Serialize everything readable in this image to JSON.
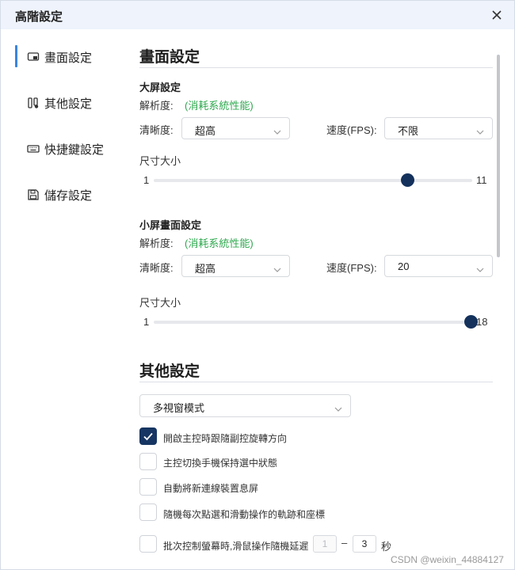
{
  "window": {
    "title": "高階設定"
  },
  "sidebar": {
    "items": [
      {
        "label": "畫面設定",
        "icon": "display-icon",
        "active": true
      },
      {
        "label": "其他設定",
        "icon": "controls-icon",
        "active": false
      },
      {
        "label": "快捷鍵設定",
        "icon": "keyboard-icon",
        "active": false
      },
      {
        "label": "儲存設定",
        "icon": "save-icon",
        "active": false
      }
    ]
  },
  "display_settings": {
    "title": "畫面設定",
    "large": {
      "title": "大屏設定",
      "resolution_label": "解析度:",
      "resolution_value": "(消耗系統性能)",
      "clarity_label": "清晰度:",
      "clarity_value": "超高",
      "fps_label": "速度(FPS):",
      "fps_value": "不限",
      "size_label": "尺寸大小",
      "size_min": "1",
      "size_max": "11",
      "size_value": 9
    },
    "small": {
      "title": "小屏畫面設定",
      "resolution_label": "解析度:",
      "resolution_value": "(消耗系統性能)",
      "clarity_label": "清晰度:",
      "clarity_value": "超高",
      "fps_label": "速度(FPS):",
      "fps_value": "20",
      "size_label": "尺寸大小",
      "size_min": "1",
      "size_max": "18",
      "size_value": 18
    }
  },
  "other_settings": {
    "title": "其他設定",
    "mode_value": "多視窗模式",
    "checkboxes": [
      {
        "label": "開啟主控時跟隨副控旋轉方向",
        "checked": true
      },
      {
        "label": "主控切換手機保持選中狀態",
        "checked": false
      },
      {
        "label": "自動將新連線裝置息屏",
        "checked": false
      },
      {
        "label": "隨機每次點選和滑動操作的軌跡和座標",
        "checked": false
      },
      {
        "label": "批次控制螢幕時,滑鼠操作隨機延遲",
        "checked": false
      }
    ],
    "delay_min": "1",
    "delay_dash": "–",
    "delay_max": "3",
    "delay_unit": "秒"
  },
  "watermark": "CSDN @weixin_44884127",
  "colors": {
    "accent": "#3a84e0",
    "thumb": "#14315c",
    "checkbox": "#163562",
    "green": "#2fa84f"
  }
}
